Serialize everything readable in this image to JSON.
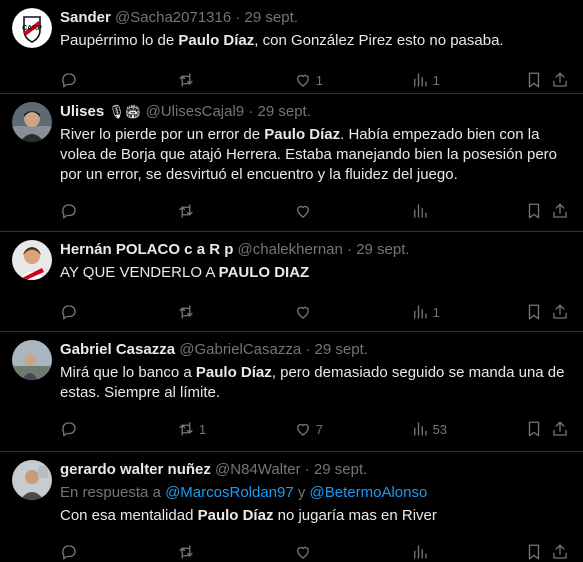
{
  "tweets": [
    {
      "name": "Sander",
      "handle": "@Sacha2071316",
      "date": "29 sept.",
      "text_parts": [
        "Paupérrimo lo de ",
        "Paulo Díaz",
        ",  con González Pirez esto no pasaba."
      ],
      "replies": "",
      "retweets": "",
      "likes": "1",
      "views": "1",
      "avatar": "river-plate-crest"
    },
    {
      "name": "Ulises",
      "name_emojis": "🎙🏟",
      "handle": "@UlisesCajal9",
      "date": "29 sept.",
      "text_parts": [
        "River lo pierde por un error de ",
        "Paulo Díaz",
        ". Había empezado bien con la volea de Borja que atajó Herrera. Estaba manejando bien la posesión pero por un error, se desvirtuó el encuentro y la fluidez del juego."
      ],
      "replies": "",
      "retweets": "",
      "likes": "",
      "views": ""
    },
    {
      "name": "Hernán POLACO c a R p",
      "handle": "@chalekhernan",
      "date": "29 sept.",
      "text_parts": [
        "AY QUE VENDERLO A ",
        "PAULO DIAZ",
        ""
      ],
      "replies": "",
      "retweets": "",
      "likes": "",
      "views": "1"
    },
    {
      "name": "Gabriel Casazza",
      "handle": "@GabrielCasazza",
      "date": "29 sept.",
      "text_parts": [
        "Mirá que lo banco a ",
        "Paulo Díaz",
        ", pero demasiado seguido se manda una de estas. Siempre al límite."
      ],
      "replies": "",
      "retweets": "1",
      "likes": "7",
      "views": "53"
    },
    {
      "name": "gerardo walter nuñez",
      "handle": "@N84Walter",
      "date": "29 sept.",
      "reply_prefix": "En respuesta a ",
      "reply_user1": "@MarcosRoldan97",
      "reply_and": " y ",
      "reply_user2": "@BetermoAlonso",
      "text_parts": [
        "Con esa mentalidad ",
        "Paulo Díaz",
        " no jugaría mas en River"
      ],
      "replies": "",
      "retweets": "",
      "likes": "",
      "views": ""
    }
  ],
  "separator": "·",
  "colors": {
    "background": "#000000",
    "text": "#e7e9ea",
    "muted": "#71767b",
    "link": "#1d9bf0",
    "border": "#2f3336"
  }
}
